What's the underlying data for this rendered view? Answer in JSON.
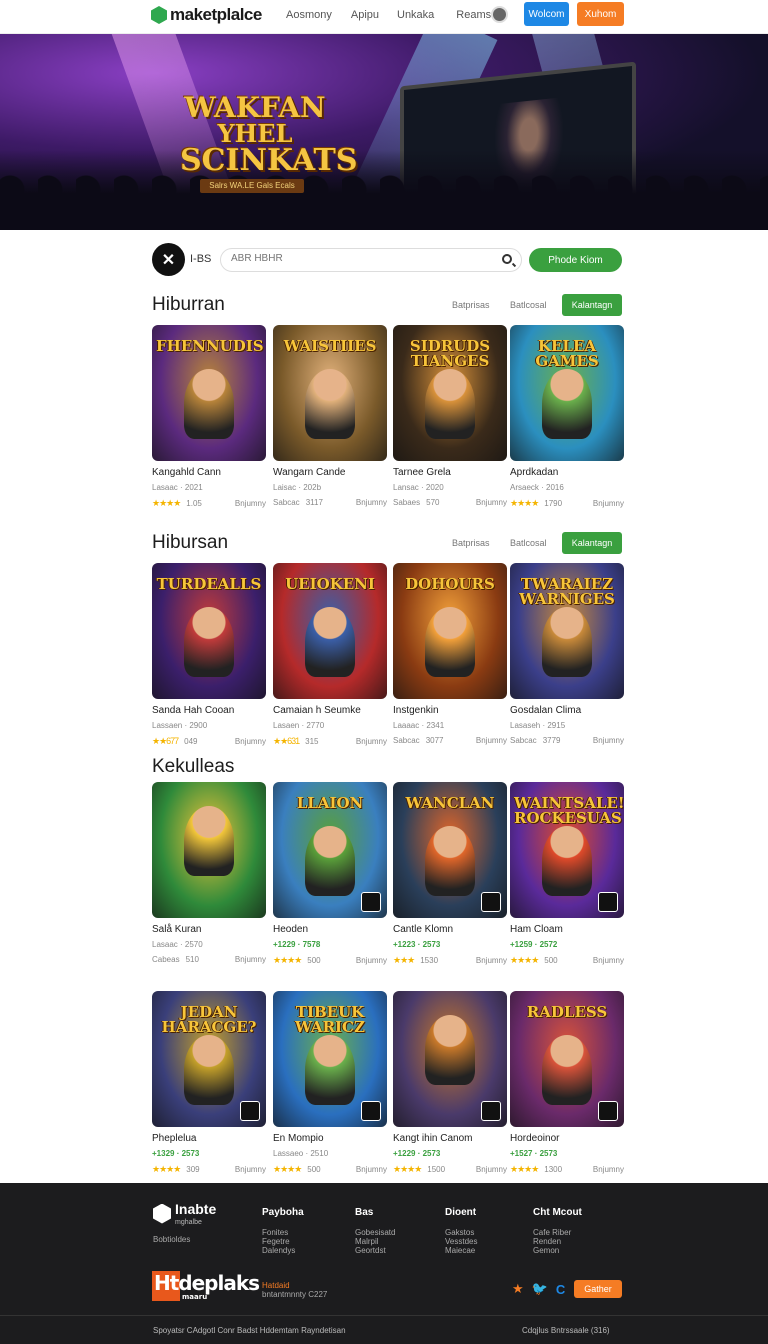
{
  "nav": {
    "logo": "maketplalce",
    "links": [
      "Aosmony",
      "Apipu",
      "Unkaka",
      "Reams"
    ],
    "btn_blue": "Wolcom",
    "btn_orange": "Xuhom"
  },
  "hero": {
    "title_lines": [
      "WAKFAN",
      "YHEL",
      "SCINKATS"
    ],
    "subtitle": "Salrs WA.LE Gals Ecals",
    "slides": 4
  },
  "search": {
    "label": "I-BS",
    "placeholder": "ABR HBHR",
    "button": "Phode Kiom"
  },
  "sections": [
    {
      "title": "Hiburran",
      "ctrl1": "Batprisas",
      "ctrl2": "Batlcosal",
      "button": "Kalantagn",
      "cards": [
        {
          "title_art": "FHENNUDIS",
          "name": "Kangahld Cann",
          "sub": "Lasaac · 2021",
          "left": "★★★★",
          "num": "1.05",
          "right": "Bnjumny",
          "bg": "#5b2a7e",
          "accent": "#b8843a"
        },
        {
          "title_art": "WAISTIIES",
          "name": "Wangarn Cande",
          "sub": "Laisac · 202b",
          "left": "Sabcac",
          "num": "3117",
          "right": "Bnjumny",
          "bg": "#7a5a2a",
          "accent": "#e0b07a"
        },
        {
          "title_art": "SIDRUDS TIANGES",
          "name": "Tarnee Grela",
          "sub": "Lansac · 2020",
          "left": "Sabaes",
          "num": "570",
          "right": "Bnjumny",
          "bg": "#3a2a1a",
          "accent": "#d9923a"
        },
        {
          "title_art": "KELEA GAMES",
          "name": "Aprdkadan",
          "sub": "Arsaeck · 2016",
          "left": "★★★★",
          "num": "1790",
          "right": "Bnjumny",
          "bg": "#2b8fbf",
          "accent": "#6ab04c"
        }
      ]
    },
    {
      "title": "Hibursan",
      "ctrl1": "Batprisas",
      "ctrl2": "Batlcosal",
      "button": "Kalantagn",
      "cards": [
        {
          "title_art": "TURDEALLS",
          "name": "Sanda Hah Cooan",
          "sub": "Lassaen · 2900",
          "left": "★★677",
          "num": "049",
          "right": "Bnjumny",
          "bg": "#3b1f6b",
          "accent": "#c13b3b"
        },
        {
          "title_art": "UEIOKENI",
          "name": "Camaian h Seumke",
          "sub": "Lasaen · 2770",
          "left": "★★631",
          "num": "315",
          "right": "Bnjumny",
          "bg": "#b52a2a",
          "accent": "#3b5fa8"
        },
        {
          "title_art": "DOHOURS",
          "name": "Instgenkin",
          "sub": "Laaaac · 2341",
          "left": "Sabcac",
          "num": "3077",
          "right": "Bnjumny",
          "bg": "#8a3b12",
          "accent": "#f2a03a"
        },
        {
          "title_art": "TWARAIEZ WARNIGES",
          "name": "Gosdalan Clima",
          "sub": "Lasaseh · 2915",
          "left": "Sabcac",
          "num": "3779",
          "right": "Bnjumny",
          "bg": "#3b3f8a",
          "accent": "#c98a3a"
        }
      ]
    },
    {
      "title": "Kekulleas",
      "ctrl1": "",
      "ctrl2": "",
      "button": "",
      "cards": [
        {
          "title_art": "",
          "name": "Salå Kuran",
          "sub": "Lasaac · 2570",
          "left": "Cabeas",
          "num": "510",
          "right": "Bnjumny",
          "bg": "#2f8a3a",
          "accent": "#f2c63a"
        },
        {
          "title_art": "LLAION",
          "name": "Heoden",
          "sub": "+1229 · 7578",
          "price": true,
          "left": "★★★★",
          "num": "500",
          "right": "Bnjumny",
          "bg": "#3a7fbf",
          "accent": "#5aa03a"
        },
        {
          "title_art": "WANCLAN",
          "name": "Cantle Klomn",
          "sub": "+1223 · 2573",
          "price": true,
          "left": "★★★",
          "num": "1530",
          "right": "Bnjumny",
          "bg": "#2a3f5a",
          "accent": "#e0662a"
        },
        {
          "title_art": "WAINTSALE! ROCKESUAS",
          "name": "Ham Cloam",
          "sub": "+1259 · 2572",
          "price": true,
          "left": "★★★★",
          "num": "500",
          "right": "Bnjumny",
          "bg": "#5a2a9a",
          "accent": "#e04a2a"
        }
      ]
    },
    {
      "title": "",
      "ctrl1": "",
      "ctrl2": "",
      "button": "",
      "cards": [
        {
          "title_art": "JEDAN HARACGE?",
          "name": "Pheplelua",
          "sub": "+1329 · 2573",
          "price": true,
          "left": "★★★★",
          "num": "309",
          "right": "Bnjumny",
          "bg": "#3a3f7a",
          "accent": "#c4a02a"
        },
        {
          "title_art": "TIBEUK WARICZ",
          "name": "En Mompio",
          "sub": "Lassaeo · 2510",
          "left": "★★★★",
          "num": "500",
          "right": "Bnjumny",
          "bg": "#2a6fbf",
          "accent": "#6ab04c"
        },
        {
          "title_art": "",
          "name": "Kangt ihin Canom",
          "sub": "+1229 · 2573",
          "price": true,
          "left": "★★★★",
          "num": "1500",
          "right": "Bnjumny",
          "bg": "#4a3a6a",
          "accent": "#c9792a"
        },
        {
          "title_art": "RADLESS",
          "name": "Hordeoinor",
          "sub": "+1527 · 2573",
          "price": true,
          "left": "★★★★",
          "num": "1300",
          "right": "Bnjumny",
          "bg": "#6a2a6a",
          "accent": "#d9533a"
        }
      ]
    }
  ],
  "footer": {
    "logo_title": "Inabte",
    "logo_sub": "mghalbe",
    "desc": "Bobtioldes",
    "cols": [
      {
        "h": "Payboha",
        "items": [
          "Fonites",
          "Fegetre",
          "Dalendys"
        ]
      },
      {
        "h": "Bas",
        "items": [
          "Gobesisatd",
          "Malrpil",
          "Geortdst"
        ]
      },
      {
        "h": "Dioent",
        "items": [
          "Gakstos",
          "Vesstdes",
          "Maiecae"
        ]
      },
      {
        "h": "Cht Mcout",
        "items": [
          "Cafe Riber",
          "Renden",
          "Gemon"
        ]
      }
    ],
    "brand": "Htdeplaks",
    "brand_sub": "maaru",
    "note_a": "Hatdaid",
    "note_b": "bntantmnnty C227",
    "social_button": "Gather",
    "bottom_left": "Spoyatsr CAdgotl Conr Badst Hddemtam Rayndetisan",
    "bottom_right": "Cdqjlus Bntrssaale (316)"
  }
}
